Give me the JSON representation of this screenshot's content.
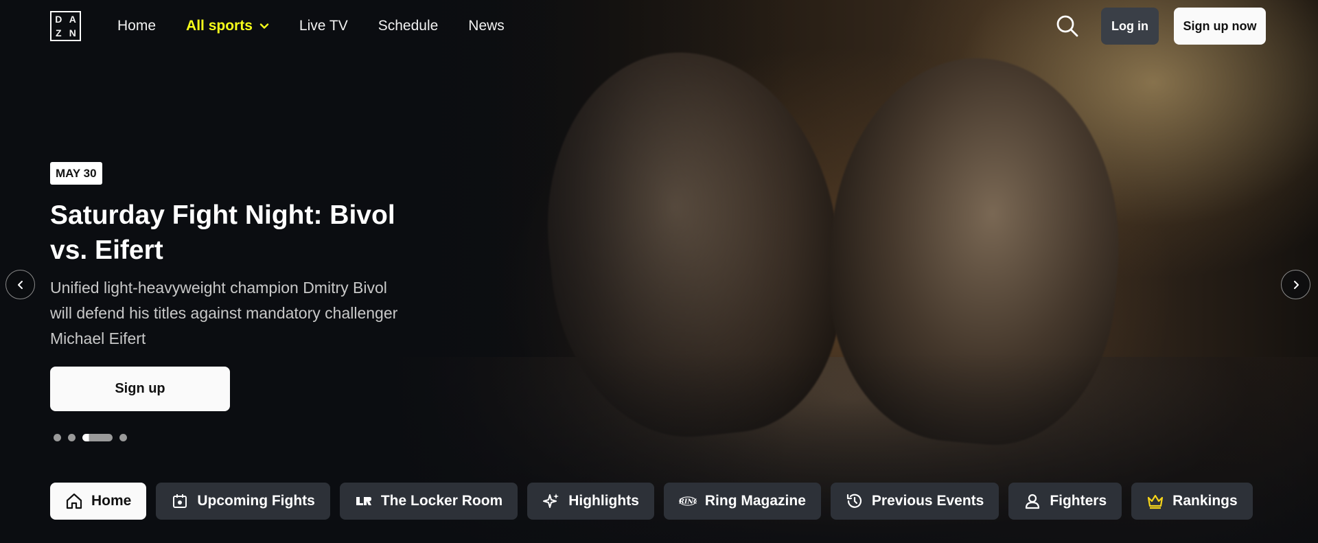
{
  "brand": {
    "logo_letters": [
      "D",
      "A",
      "Z",
      "N"
    ],
    "accent": "#f7ff1a"
  },
  "nav": {
    "items": [
      {
        "label": "Home"
      },
      {
        "label": "All sports"
      },
      {
        "label": "Live TV"
      },
      {
        "label": "Schedule"
      },
      {
        "label": "News"
      }
    ],
    "active_index": 1,
    "search_icon": "search-icon",
    "login_label": "Log in",
    "signup_label": "Sign up now"
  },
  "hero": {
    "date": "MAY 30",
    "title": "Saturday Fight Night: Bivol vs. Eifert",
    "description": "Unified light-heavyweight champion Dmitry Bivol will defend his titles against mandatory challenger Michael Eifert",
    "cta_label": "Sign up",
    "slide_count": 4,
    "active_slide": 2
  },
  "tabs": [
    {
      "label": "Home",
      "icon": "home-icon",
      "active": true
    },
    {
      "label": "Upcoming Fights",
      "icon": "calendar-icon",
      "active": false
    },
    {
      "label": "The Locker Room",
      "icon": "locker-room-icon",
      "active": false
    },
    {
      "label": "Highlights",
      "icon": "sparkle-icon",
      "active": false
    },
    {
      "label": "Ring Magazine",
      "icon": "ring-magazine-icon",
      "active": false
    },
    {
      "label": "Previous Events",
      "icon": "history-icon",
      "active": false
    },
    {
      "label": "Fighters",
      "icon": "person-icon",
      "active": false
    },
    {
      "label": "Rankings",
      "icon": "crown-icon",
      "active": false
    }
  ]
}
